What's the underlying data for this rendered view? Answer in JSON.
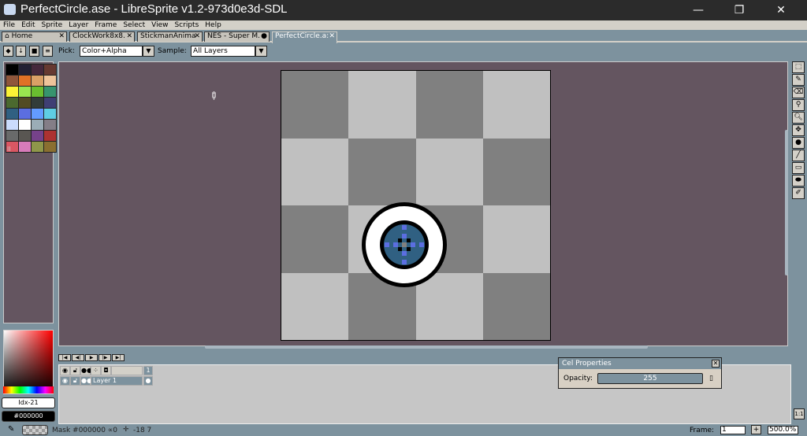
{
  "window": {
    "title": "PerfectCircle.ase - LibreSprite v1.2-973d0e3d-SDL",
    "minimize": "—",
    "maximize": "❐",
    "close": "✕"
  },
  "menu": [
    "File",
    "Edit",
    "Sprite",
    "Layer",
    "Frame",
    "Select",
    "View",
    "Scripts",
    "Help"
  ],
  "tabs": [
    {
      "label": "⌂ Home",
      "close": "✕"
    },
    {
      "label": "ClockWork8x8.",
      "close": "✕"
    },
    {
      "label": "StickmanAnima",
      "close": "✕"
    },
    {
      "label": "NES - Super M.",
      "close": "●"
    },
    {
      "label": "PerfectCircle.a:",
      "close": "✕"
    }
  ],
  "toolbar": {
    "pick_label": "Pick:",
    "pick_value": "Color+Alpha",
    "sample_label": "Sample:",
    "sample_value": "All Layers"
  },
  "palette": [
    "#000000",
    "#222034",
    "#45283c",
    "#663931",
    "#8f563b",
    "#df7126",
    "#d9a066",
    "#eec39a",
    "#fbf236",
    "#99e550",
    "#6abe30",
    "#37946e",
    "#4b692f",
    "#524b24",
    "#323c39",
    "#3f3f74",
    "#306082",
    "#5b6ee1",
    "#639bff",
    "#5fcde4",
    "#cbdbfc",
    "#ffffff",
    "#9badb7",
    "#847e87",
    "#696a6a",
    "#595652",
    "#76428a",
    "#ac3232",
    "#d95763",
    "#d77bba",
    "#8f974a",
    "#8a6f30"
  ],
  "color": {
    "index": "Idx-21",
    "hex": "#000000"
  },
  "colors": {
    "editor_bg": "#645560",
    "checker_dark": "#808080",
    "checker_light": "#c0c0c0",
    "circle_blue": "#306082",
    "accent_blue": "#5b6ee1"
  },
  "timeline": {
    "frame_header": "1",
    "layer_name": "Layer 1"
  },
  "cel_properties": {
    "title": "Cel Properties",
    "opacity_label": "Opacity:",
    "opacity_value": "255"
  },
  "status": {
    "text": "Mask #000000 ∝0",
    "coords": "-18 7",
    "frame_label": "Frame:",
    "frame_value": "1",
    "zoom": "500.0%",
    "one_to_one": "1:1",
    "add": "+"
  }
}
